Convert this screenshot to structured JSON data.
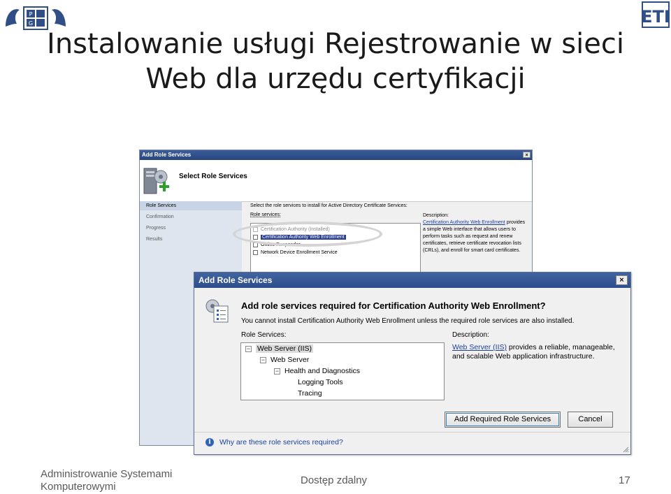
{
  "slide": {
    "title_line1": "Instalowanie usługi Rejestrowanie w sieci",
    "title_line2": "Web dla urzędu certyfikacji",
    "footer_course_line1": "Administrowanie Systemami",
    "footer_course_line2": "Komputerowymi",
    "footer_topic": "Dostęp zdalny",
    "page_number": "17",
    "logo_left_letters": [
      "P",
      "G"
    ],
    "logo_right_text": "ETI"
  },
  "back_dialog": {
    "title": "Add Role Services",
    "close_glyph": "×",
    "header_title": "Select Role Services",
    "nav": [
      "Role Services",
      "Confirmation",
      "Progress",
      "Results"
    ],
    "instruction": "Select the role services to install for Active Directory Certificate Services:",
    "list_label": "Role services:",
    "role_services": [
      {
        "label": "Certification Authority  (Installed)",
        "checked": true,
        "disabled": true
      },
      {
        "label": "Certification Authority Web Enrollment",
        "checked": false,
        "selected": true
      },
      {
        "label": "Online Responder",
        "checked": false
      },
      {
        "label": "Network Device Enrollment Service",
        "checked": false
      }
    ],
    "description_label": "Description:",
    "description_link": "Certification Authority Web Enrollment",
    "description_text": "provides a simple Web interface that allows users to perform tasks such as request and renew certificates, retrieve certificate revocation lists (CRLs), and enroll for smart card certificates."
  },
  "front_dialog": {
    "title": "Add Role Services",
    "close_glyph": "×",
    "heading": "Add role services required for Certification Authority Web Enrollment?",
    "info": "You cannot install Certification Authority Web Enrollment unless the required role services are also installed.",
    "role_services_label": "Role Services:",
    "description_label": "Description:",
    "tree": [
      {
        "label": "Web Server (IIS)",
        "level": 0,
        "expander": "−"
      },
      {
        "label": "Web Server",
        "level": 1,
        "expander": "−"
      },
      {
        "label": "Health and Diagnostics",
        "level": 2,
        "expander": "−"
      },
      {
        "label": "Logging Tools",
        "level": 3,
        "expander": ""
      },
      {
        "label": "Tracing",
        "level": 3,
        "expander": ""
      }
    ],
    "description_link": "Web Server (IIS)",
    "description_text": " provides a reliable, manageable, and scalable Web application infrastructure.",
    "add_button": "Add Required Role Services",
    "cancel_button": "Cancel",
    "help_link": "Why are these role services required?"
  }
}
